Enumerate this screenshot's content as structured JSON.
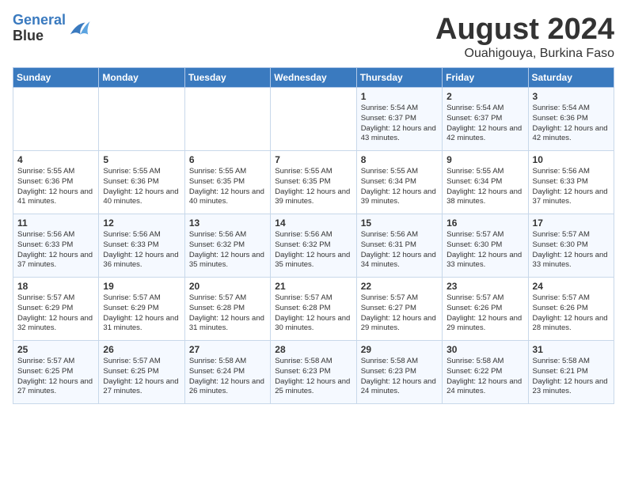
{
  "header": {
    "logo_line1": "General",
    "logo_line2": "Blue",
    "month_year": "August 2024",
    "location": "Ouahigouya, Burkina Faso"
  },
  "weekdays": [
    "Sunday",
    "Monday",
    "Tuesday",
    "Wednesday",
    "Thursday",
    "Friday",
    "Saturday"
  ],
  "weeks": [
    [
      {
        "day": "",
        "content": ""
      },
      {
        "day": "",
        "content": ""
      },
      {
        "day": "",
        "content": ""
      },
      {
        "day": "",
        "content": ""
      },
      {
        "day": "1",
        "content": "Sunrise: 5:54 AM\nSunset: 6:37 PM\nDaylight: 12 hours and 43 minutes."
      },
      {
        "day": "2",
        "content": "Sunrise: 5:54 AM\nSunset: 6:37 PM\nDaylight: 12 hours and 42 minutes."
      },
      {
        "day": "3",
        "content": "Sunrise: 5:54 AM\nSunset: 6:36 PM\nDaylight: 12 hours and 42 minutes."
      }
    ],
    [
      {
        "day": "4",
        "content": "Sunrise: 5:55 AM\nSunset: 6:36 PM\nDaylight: 12 hours and 41 minutes."
      },
      {
        "day": "5",
        "content": "Sunrise: 5:55 AM\nSunset: 6:36 PM\nDaylight: 12 hours and 40 minutes."
      },
      {
        "day": "6",
        "content": "Sunrise: 5:55 AM\nSunset: 6:35 PM\nDaylight: 12 hours and 40 minutes."
      },
      {
        "day": "7",
        "content": "Sunrise: 5:55 AM\nSunset: 6:35 PM\nDaylight: 12 hours and 39 minutes."
      },
      {
        "day": "8",
        "content": "Sunrise: 5:55 AM\nSunset: 6:34 PM\nDaylight: 12 hours and 39 minutes."
      },
      {
        "day": "9",
        "content": "Sunrise: 5:55 AM\nSunset: 6:34 PM\nDaylight: 12 hours and 38 minutes."
      },
      {
        "day": "10",
        "content": "Sunrise: 5:56 AM\nSunset: 6:33 PM\nDaylight: 12 hours and 37 minutes."
      }
    ],
    [
      {
        "day": "11",
        "content": "Sunrise: 5:56 AM\nSunset: 6:33 PM\nDaylight: 12 hours and 37 minutes."
      },
      {
        "day": "12",
        "content": "Sunrise: 5:56 AM\nSunset: 6:33 PM\nDaylight: 12 hours and 36 minutes."
      },
      {
        "day": "13",
        "content": "Sunrise: 5:56 AM\nSunset: 6:32 PM\nDaylight: 12 hours and 35 minutes."
      },
      {
        "day": "14",
        "content": "Sunrise: 5:56 AM\nSunset: 6:32 PM\nDaylight: 12 hours and 35 minutes."
      },
      {
        "day": "15",
        "content": "Sunrise: 5:56 AM\nSunset: 6:31 PM\nDaylight: 12 hours and 34 minutes."
      },
      {
        "day": "16",
        "content": "Sunrise: 5:57 AM\nSunset: 6:30 PM\nDaylight: 12 hours and 33 minutes."
      },
      {
        "day": "17",
        "content": "Sunrise: 5:57 AM\nSunset: 6:30 PM\nDaylight: 12 hours and 33 minutes."
      }
    ],
    [
      {
        "day": "18",
        "content": "Sunrise: 5:57 AM\nSunset: 6:29 PM\nDaylight: 12 hours and 32 minutes."
      },
      {
        "day": "19",
        "content": "Sunrise: 5:57 AM\nSunset: 6:29 PM\nDaylight: 12 hours and 31 minutes."
      },
      {
        "day": "20",
        "content": "Sunrise: 5:57 AM\nSunset: 6:28 PM\nDaylight: 12 hours and 31 minutes."
      },
      {
        "day": "21",
        "content": "Sunrise: 5:57 AM\nSunset: 6:28 PM\nDaylight: 12 hours and 30 minutes."
      },
      {
        "day": "22",
        "content": "Sunrise: 5:57 AM\nSunset: 6:27 PM\nDaylight: 12 hours and 29 minutes."
      },
      {
        "day": "23",
        "content": "Sunrise: 5:57 AM\nSunset: 6:26 PM\nDaylight: 12 hours and 29 minutes."
      },
      {
        "day": "24",
        "content": "Sunrise: 5:57 AM\nSunset: 6:26 PM\nDaylight: 12 hours and 28 minutes."
      }
    ],
    [
      {
        "day": "25",
        "content": "Sunrise: 5:57 AM\nSunset: 6:25 PM\nDaylight: 12 hours and 27 minutes."
      },
      {
        "day": "26",
        "content": "Sunrise: 5:57 AM\nSunset: 6:25 PM\nDaylight: 12 hours and 27 minutes."
      },
      {
        "day": "27",
        "content": "Sunrise: 5:58 AM\nSunset: 6:24 PM\nDaylight: 12 hours and 26 minutes."
      },
      {
        "day": "28",
        "content": "Sunrise: 5:58 AM\nSunset: 6:23 PM\nDaylight: 12 hours and 25 minutes."
      },
      {
        "day": "29",
        "content": "Sunrise: 5:58 AM\nSunset: 6:23 PM\nDaylight: 12 hours and 24 minutes."
      },
      {
        "day": "30",
        "content": "Sunrise: 5:58 AM\nSunset: 6:22 PM\nDaylight: 12 hours and 24 minutes."
      },
      {
        "day": "31",
        "content": "Sunrise: 5:58 AM\nSunset: 6:21 PM\nDaylight: 12 hours and 23 minutes."
      }
    ]
  ]
}
